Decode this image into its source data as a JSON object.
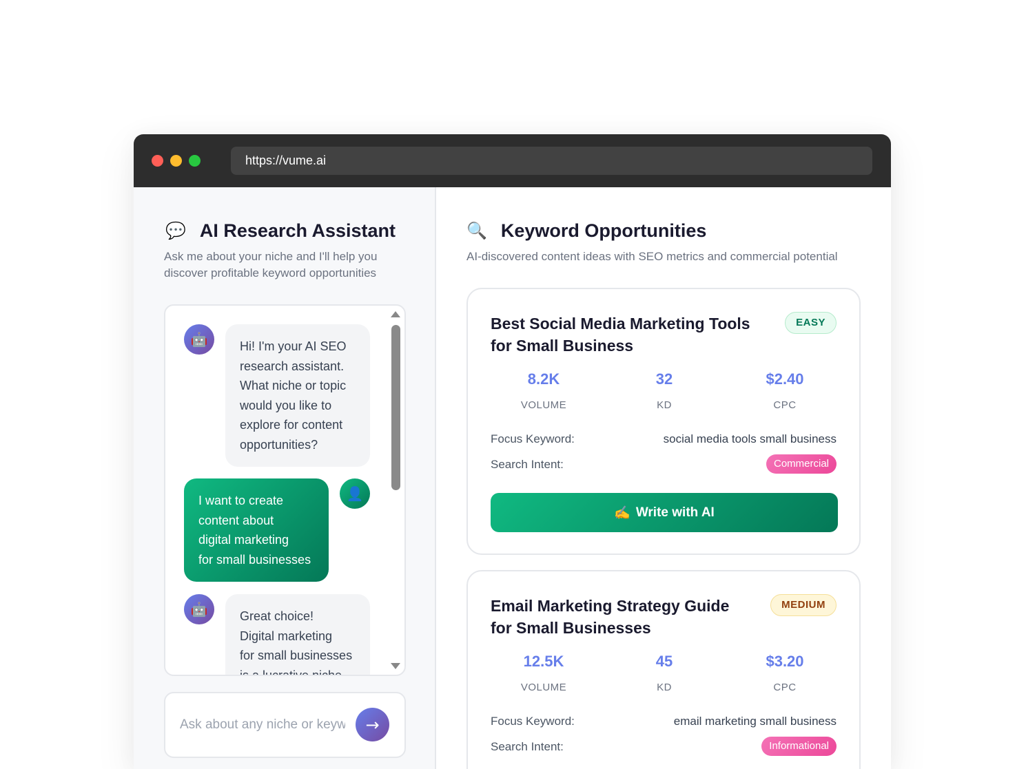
{
  "browser": {
    "url": "https://vume.ai"
  },
  "assistant": {
    "icon": "💬",
    "title": "AI Research Assistant",
    "subtitle_line1": "Ask me about your niche and I'll help you",
    "subtitle_line2": "discover profitable keyword opportunities",
    "messages": [
      {
        "role": "bot",
        "avatar": "🤖",
        "lines": [
          "Hi! I'm your AI SEO",
          "research assistant.",
          "What niche or topic",
          "would you like to",
          "explore for content",
          "opportunities?"
        ]
      },
      {
        "role": "user",
        "avatar": "👤",
        "lines": [
          "I want to create",
          "content about",
          "digital marketing",
          "for small businesses"
        ]
      },
      {
        "role": "bot",
        "avatar": "🤖",
        "lines": [
          "Great choice!",
          "Digital marketing",
          "for small businesses",
          "is a lucrative niche"
        ]
      }
    ],
    "input_placeholder": "Ask about any niche or keyword...",
    "send_icon": "→"
  },
  "keywords": {
    "icon": "🔍",
    "title": "Keyword Opportunities",
    "subtitle": "AI-discovered content ideas with SEO metrics and commercial potential",
    "focus_label": "Focus Keyword:",
    "intent_label": "Search Intent:",
    "write_button_icon": "✍️",
    "write_button_label": "Write with AI",
    "metric_labels": {
      "volume": "VOLUME",
      "kd": "KD",
      "cpc": "CPC"
    },
    "cards": [
      {
        "title_line1": "Best Social Media Marketing Tools",
        "title_line2": "for Small Business",
        "difficulty": "EASY",
        "volume": "8.2K",
        "kd": "32",
        "cpc": "$2.40",
        "focus_keyword": "social media tools small business",
        "intent": "Commercial"
      },
      {
        "title_line1": "Email Marketing Strategy Guide",
        "title_line2": "for Small Businesses",
        "difficulty": "MEDIUM",
        "volume": "12.5K",
        "kd": "45",
        "cpc": "$3.20",
        "focus_keyword": "email marketing small business",
        "intent": "Informational"
      }
    ]
  },
  "colors": {
    "accent_purple": "#667eea",
    "accent_green": "#10b981",
    "intent_pink": "#ec4899"
  }
}
